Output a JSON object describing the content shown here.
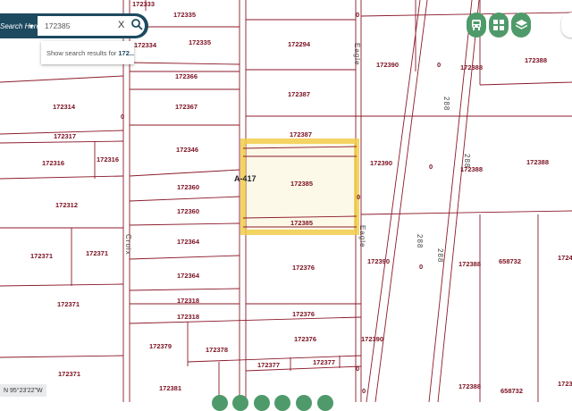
{
  "search": {
    "label": "Search Here:",
    "value": "172385",
    "clear_label": "X",
    "suggestion_prefix": "Show search results for",
    "suggestion_term": "172..."
  },
  "map": {
    "colors": {
      "parcel_line": "#8b1a2a",
      "highlight": "#f2cd4a",
      "control": "#4f9a6a",
      "search_bar": "#1d4a5f"
    },
    "survey_label": "A-417",
    "road_labels": [
      "Croix",
      "Eagle",
      "Eagle",
      "288",
      "288",
      "288",
      "288"
    ],
    "zero_labels": [
      "0",
      "0",
      "0",
      "0",
      "0",
      "0",
      "0",
      "0"
    ],
    "parcels": [
      "172333",
      "172335",
      "172334",
      "172335",
      "172294",
      "172390",
      "172388",
      "172388",
      "172366",
      "172314",
      "172367",
      "172387",
      "172387",
      "172317",
      "172346",
      "172316",
      "172316",
      "172390",
      "172388",
      "172388",
      "172360",
      "172385",
      "172312",
      "172360",
      "172385",
      "172364",
      "172371",
      "172371",
      "172376",
      "172390",
      "172388",
      "658732",
      "1724",
      "172364",
      "172371",
      "172318",
      "172318",
      "172376",
      "172379",
      "172378",
      "172376",
      "172390",
      "172371",
      "172377",
      "172377",
      "172381",
      "172388",
      "658732",
      "1723"
    ]
  },
  "coordinates": "N 95°23'22\"W",
  "controls": [
    "street-view-icon",
    "grid-icon",
    "layers-icon"
  ]
}
